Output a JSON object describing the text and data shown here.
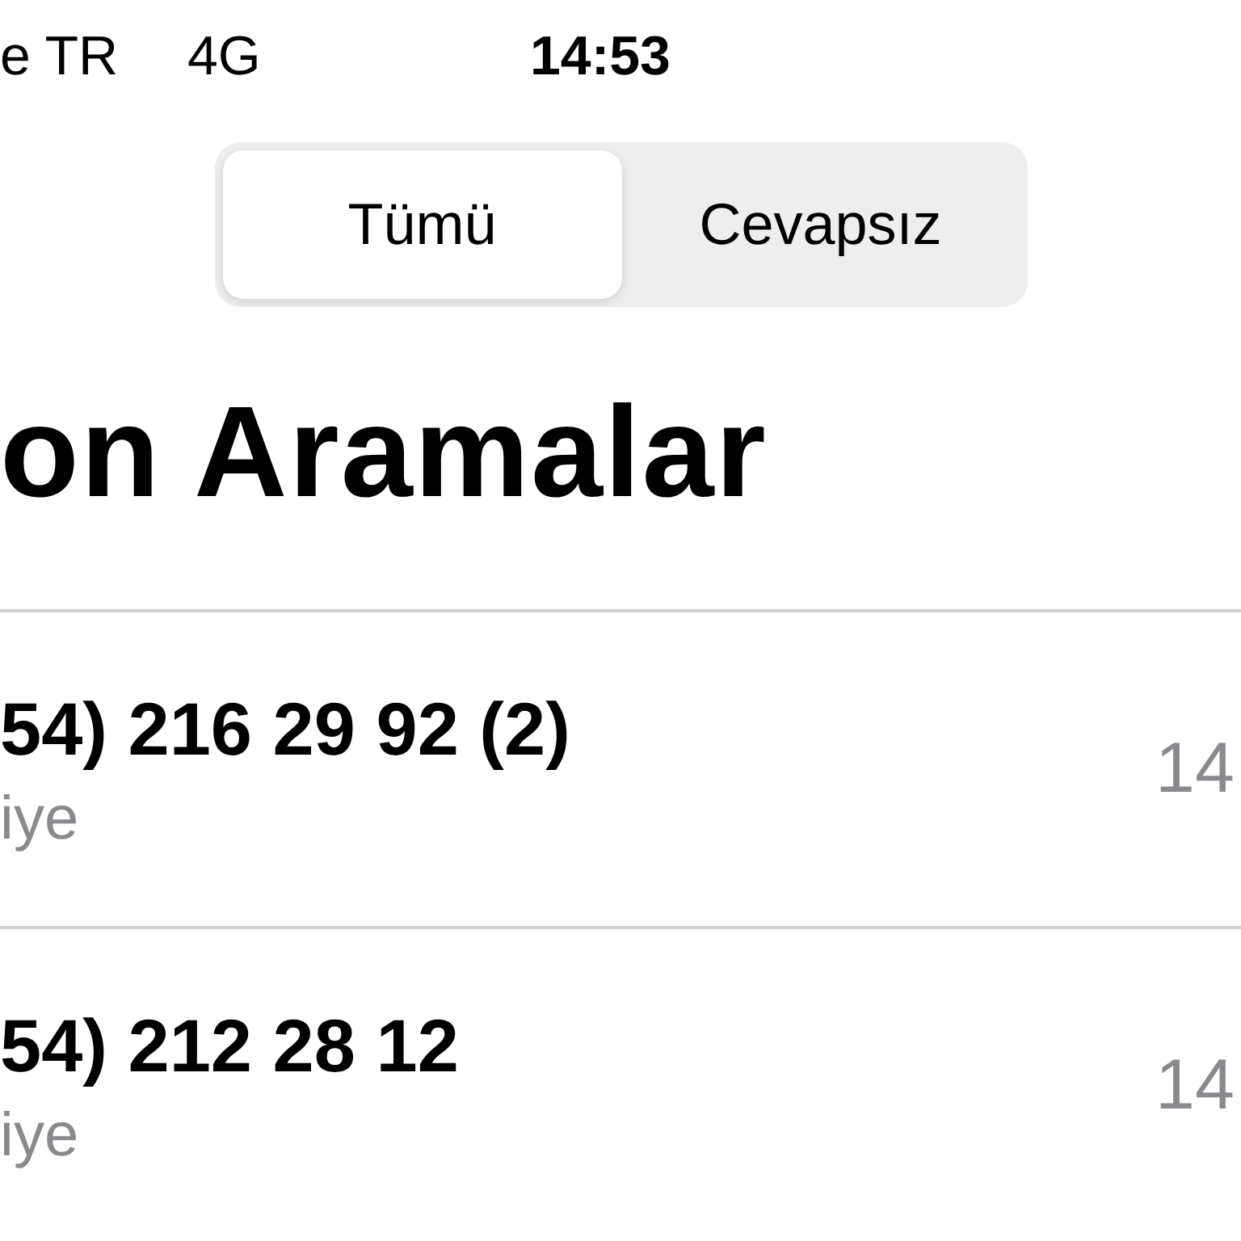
{
  "status_bar": {
    "carrier": "e TR",
    "network": "4G",
    "time": "14:53"
  },
  "segments": [
    {
      "label": "Tümü",
      "selected": true
    },
    {
      "label": "Cevapsız",
      "selected": false
    }
  ],
  "title": "on Aramalar",
  "calls": [
    {
      "number": "54) 216 29 92 (2)",
      "subtitle": "iye",
      "time": "14"
    },
    {
      "number": "54) 212 28 12",
      "subtitle": "iye",
      "time": "14"
    }
  ]
}
